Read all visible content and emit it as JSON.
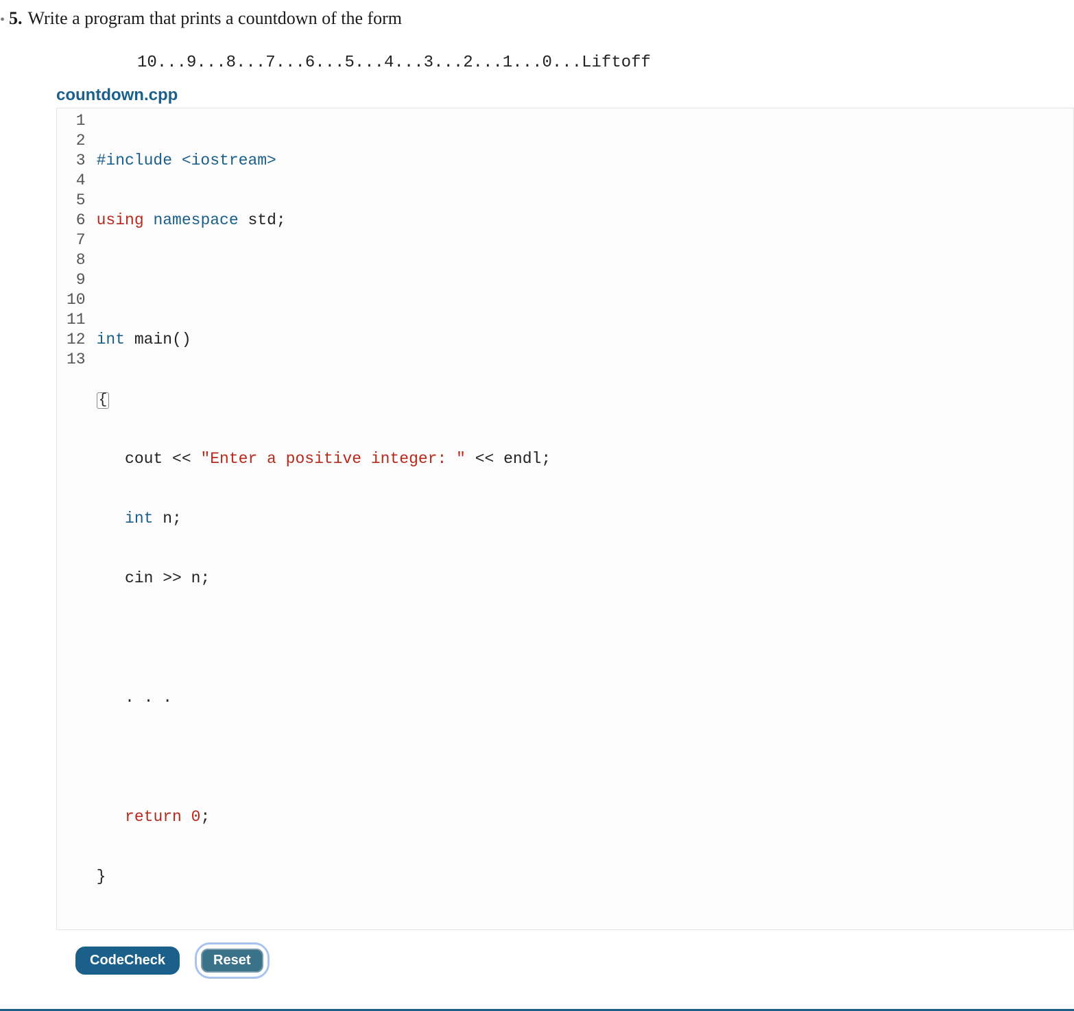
{
  "problem": {
    "bullet": "•",
    "number": "5.",
    "text": "Write a program that prints a countdown of the form"
  },
  "sample_output": "10...9...8...7...6...5...4...3...2...1...0...Liftoff",
  "filename": "countdown.cpp",
  "code": {
    "line_numbers": [
      "1",
      "2",
      "3",
      "4",
      "5",
      "6",
      "7",
      "8",
      "9",
      "10",
      "11",
      "12",
      "13"
    ],
    "tokens": {
      "l1_preproc": "#include <iostream>",
      "l2_using": "using",
      "l2_namespace": "namespace",
      "l2_std": "std",
      "l2_semi": ";",
      "l4_type": "int",
      "l4_name": " main()",
      "l5_brace": "{",
      "l6_indent": "   cout << ",
      "l6_string": "\"Enter a positive integer: \"",
      "l6_rest": " << endl;",
      "l7_indent": "   ",
      "l7_type": "int",
      "l7_rest": " n;",
      "l8_line": "   cin >> n;",
      "l10_line": "   . . .",
      "l12_indent": "   ",
      "l12_return": "return",
      "l12_sp": " ",
      "l12_num": "0",
      "l12_semi": ";",
      "l13_brace": "}"
    }
  },
  "buttons": {
    "codecheck": "CodeCheck",
    "reset": "Reset"
  }
}
